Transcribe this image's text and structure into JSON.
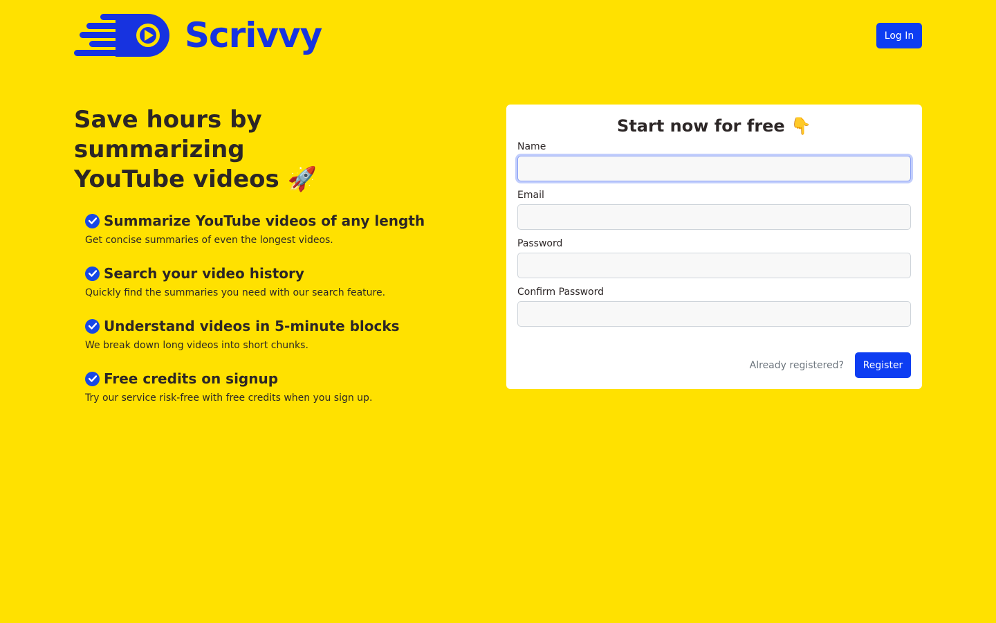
{
  "header": {
    "brand": "Scrivvy",
    "login_label": "Log In"
  },
  "hero": {
    "title_line1": "Save hours by summarizing",
    "title_line2": "YouTube videos",
    "title_emoji": "🚀",
    "features": [
      {
        "title": "Summarize YouTube videos of any length",
        "desc": "Get concise summaries of even the longest videos."
      },
      {
        "title": "Search your video history",
        "desc": "Quickly find the summaries you need with our search feature."
      },
      {
        "title": "Understand videos in 5-minute blocks",
        "desc": "We break down long videos into short chunks."
      },
      {
        "title": "Free credits on signup",
        "desc": "Try our service risk-free with free credits when you sign up."
      }
    ]
  },
  "form": {
    "title": "Start now for free",
    "title_emoji": "👇",
    "fields": [
      {
        "label": "Name",
        "value": ""
      },
      {
        "label": "Email",
        "value": ""
      },
      {
        "label": "Password",
        "value": ""
      },
      {
        "label": "Confirm Password",
        "value": ""
      }
    ],
    "already_label": "Already registered?",
    "register_label": "Register"
  },
  "colors": {
    "background": "#ffe100",
    "brand": "#1733e0",
    "button": "#0d3df2"
  }
}
